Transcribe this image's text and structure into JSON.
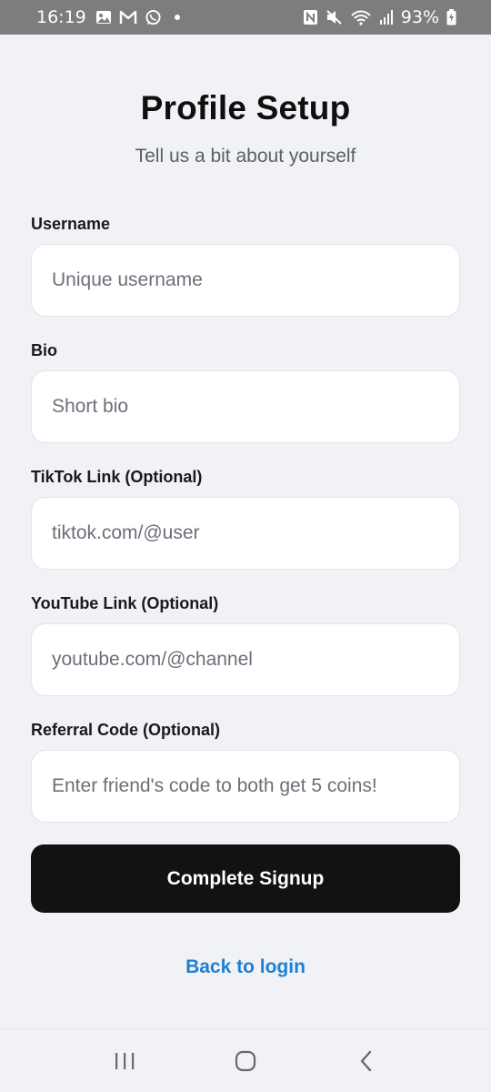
{
  "status_bar": {
    "time": "16:19",
    "battery": "93%",
    "icons": [
      "image-icon",
      "gmail-icon",
      "whatsapp-icon",
      "notification-dot",
      "nfc-icon",
      "mute-icon",
      "wifi-icon",
      "signal-icon",
      "battery-charging-icon"
    ]
  },
  "header": {
    "title": "Profile Setup",
    "subtitle": "Tell us a bit about yourself"
  },
  "form": {
    "username": {
      "label": "Username",
      "placeholder": "Unique username",
      "value": ""
    },
    "bio": {
      "label": "Bio",
      "placeholder": "Short bio",
      "value": ""
    },
    "tiktok": {
      "label": "TikTok Link (Optional)",
      "placeholder": "tiktok.com/@user",
      "value": ""
    },
    "youtube": {
      "label": "YouTube Link (Optional)",
      "placeholder": "youtube.com/@channel",
      "value": ""
    },
    "referral": {
      "label": "Referral Code (Optional)",
      "placeholder": "Enter friend's code to both get 5 coins!",
      "value": ""
    },
    "submit_label": "Complete Signup",
    "back_label": "Back to login"
  },
  "nav": {
    "recents": "recents-icon",
    "home": "home-icon",
    "back": "back-icon"
  },
  "colors": {
    "background": "#f1f2f6",
    "primary_button": "#121212",
    "link": "#1f7fd1",
    "status_bar": "#7d7d7d"
  }
}
